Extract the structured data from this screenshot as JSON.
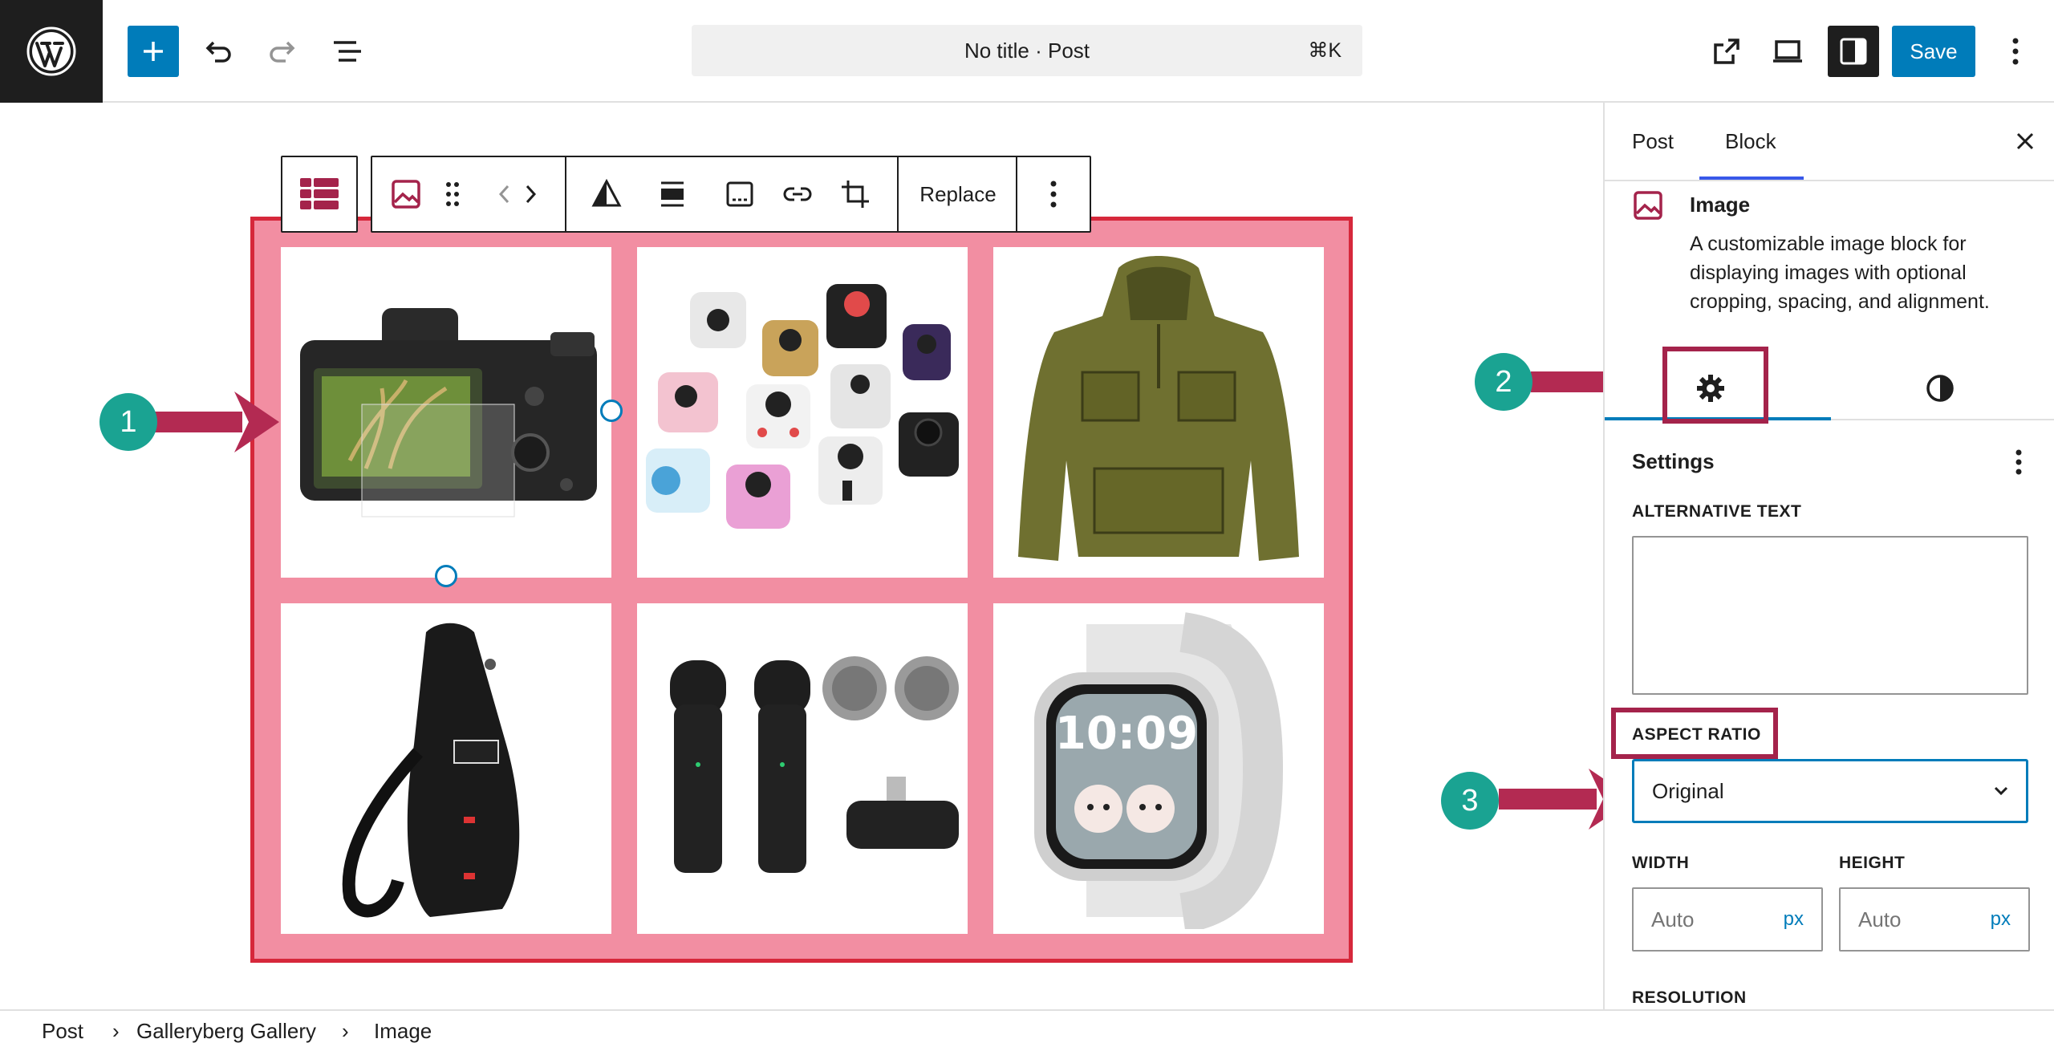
{
  "header": {
    "document_title": "No title · Post",
    "shortcut": "⌘K",
    "save_label": "Save"
  },
  "block_toolbar": {
    "replace_label": "Replace"
  },
  "sidebar": {
    "tabs": [
      "Post",
      "Block"
    ],
    "active_tab": "Block",
    "block_name": "Image",
    "block_description": "A customizable image block for displaying images with optional cropping, spacing, and alignment.",
    "settings_title": "Settings",
    "alt_text_label": "ALTERNATIVE TEXT",
    "alt_text_value": "",
    "aspect_ratio_label": "ASPECT RATIO",
    "aspect_ratio_value": "Original",
    "width_label": "WIDTH",
    "height_label": "HEIGHT",
    "width_placeholder": "Auto",
    "height_placeholder": "Auto",
    "unit": "px",
    "resolution_label": "RESOLUTION"
  },
  "callouts": [
    "1",
    "2",
    "3"
  ],
  "breadcrumb": [
    "Post",
    "Galleryberg Gallery",
    "Image"
  ],
  "gallery": {
    "items": [
      "camera-image",
      "fidget-cubes-image",
      "hoodie-image",
      "sling-bag-image",
      "wireless-microphones-image",
      "smartwatch-image"
    ]
  },
  "colors": {
    "accent": "#007cba",
    "gallery_background": "#f28ea2",
    "gallery_border": "#d6283b",
    "callout_badge": "#1aa392",
    "callout_arrow": "#b32a52"
  }
}
